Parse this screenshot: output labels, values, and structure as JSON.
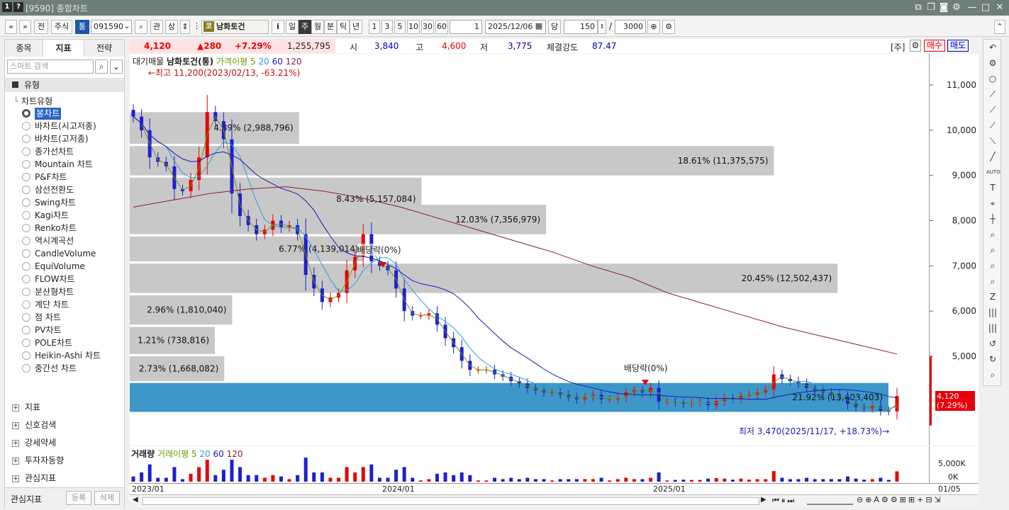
{
  "window": {
    "badge1": "1",
    "badge2": "?",
    "title": "[9590] 종합차트"
  },
  "toolbar": {
    "nav1": "«",
    "nav2": "»",
    "btn_jeon": "전",
    "btn_stock": "주식",
    "btn_tong": "통",
    "code": "091590",
    "search_icon": "⌕",
    "btn_gwan": "관",
    "btn_sang": "상",
    "sector_badge": "코",
    "name": "남화토건",
    "info": "i",
    "periods": [
      "일",
      "주",
      "월",
      "분",
      "틱",
      "년"
    ],
    "selected_period": "주",
    "intervals": [
      "1",
      "3",
      "5",
      "10",
      "30",
      "60"
    ],
    "interval_value": "1",
    "date": "2025/12/06",
    "dang": "당",
    "count": "150",
    "slash": "/",
    "max": "3000"
  },
  "left": {
    "tabs": [
      "종목",
      "지표",
      "전략"
    ],
    "selected_tab": "지표",
    "search_placeholder": "스마트 검색",
    "section": "유형",
    "subsection": "차트유형",
    "items": [
      "봉차트",
      "바차트(시고저종)",
      "바차트(고저종)",
      "종가선차트",
      "Mountain 차트",
      "P&F차트",
      "삼선전환도",
      "Swing차트",
      "Kagi차트",
      "Renko차트",
      "역시계곡선",
      "CandleVolume",
      "EquiVolume",
      "FLOW차트",
      "분산형차트",
      "계단 차트",
      "점 차트",
      "PV차트",
      "POLE차트",
      "Heikin-Ashi 차트",
      "중간선 차트"
    ],
    "groups": [
      "지표",
      "신호검색",
      "강세약세",
      "투자자동향",
      "관심지표"
    ],
    "footer_label": "관심지표",
    "footer_btn1": "등록",
    "footer_btn2": "삭제"
  },
  "quote": {
    "price": "4,120",
    "change": "▲280",
    "pct": "+7.29%",
    "volume": "1,255,795",
    "open_label": "시",
    "open": "3,840",
    "high_label": "고",
    "high": "4,600",
    "low_label": "저",
    "low": "3,775",
    "strength_label": "체결강도",
    "strength": "87.47",
    "unit": "[주]",
    "buy": "매수",
    "sell": "매도"
  },
  "legend": {
    "l1": "대기매물",
    "l2": "남화토건(통)",
    "l3": "가격이평",
    "n5": "5",
    "n20": "20",
    "n60": "60",
    "n120": "120"
  },
  "annotations": {
    "high": "←최고 11,200(2023/02/13, -63.21%)",
    "low": "최저 3,470(2025/11/17, +18.73%)→",
    "div1": "배당락(0%)",
    "div2": "배당락(0%)",
    "last_price": "4,120",
    "last_pct": "(7.29%)"
  },
  "volume_legend": {
    "l1": "거래량",
    "l2": "거래이평",
    "n5": "5",
    "n20": "20",
    "n60": "60",
    "n120": "120"
  },
  "volume_axis": [
    "5,000K",
    "0K"
  ],
  "x_labels": [
    "2023/01",
    "2024/01",
    "2025/01",
    "01/05"
  ],
  "colors": {
    "up": "#e8000b",
    "down": "#1f1fd0",
    "ma5": "#6b9a00",
    "ma20": "#2b9fd8",
    "ma60": "#1a1ab8",
    "ma120": "#8b1a3a",
    "profile": "#c8c8c8",
    "profile_hl": "#3d97c8"
  },
  "chart_data": {
    "type": "candlestick",
    "ylim": [
      3000,
      11900
    ],
    "yticks": [
      5000,
      6000,
      7000,
      8000,
      9000,
      10000,
      11000
    ],
    "volume_profile": [
      {
        "low": 9700,
        "high": 10400,
        "pct": "4.89%",
        "vol": "2,988,796",
        "label": "4.89% (2,988,796)"
      },
      {
        "low": 9000,
        "high": 9650,
        "pct": "18.61%",
        "vol": "11,375,575",
        "label": "18.61% (11,375,575)"
      },
      {
        "low": 8000,
        "high": 8950,
        "pct": "8.43%",
        "vol": "5,157,084",
        "label": "8.43% (5,157,084)"
      },
      {
        "low": 7700,
        "high": 8350,
        "pct": "12.03%",
        "vol": "7,356,979",
        "label": "12.03% (7,356,979)"
      },
      {
        "low": 7100,
        "high": 7650,
        "pct": "6.77%",
        "vol": "4,139,014",
        "label": "6.77% (4,139,014)"
      },
      {
        "low": 6400,
        "high": 7050,
        "pct": "20.45%",
        "vol": "12,502,437",
        "label": "20.45% (12,502,437)"
      },
      {
        "low": 5700,
        "high": 6350,
        "pct": "2.96%",
        "vol": "1,810,040",
        "label": "2.96% (1,810,040)"
      },
      {
        "low": 5050,
        "high": 5650,
        "pct": "1.21%",
        "vol": "738,816",
        "label": "1.21% (738,816)"
      },
      {
        "low": 4450,
        "high": 5000,
        "pct": "2.73%",
        "vol": "1,668,082",
        "label": "2.73% (1,668,082)"
      },
      {
        "low": 3770,
        "high": 4410,
        "pct": "21.92%",
        "vol": "13,403,403",
        "label": "21.92% (13,403,403)",
        "highlight": true
      }
    ],
    "close": [
      10300,
      10000,
      9400,
      9300,
      9200,
      8700,
      8650,
      8900,
      9400,
      10400,
      10200,
      9800,
      8600,
      8100,
      7900,
      7700,
      7800,
      8000,
      7850,
      7900,
      7700,
      6800,
      6500,
      6200,
      6300,
      6400,
      6900,
      7200,
      7700,
      7100,
      7000,
      6900,
      6500,
      6000,
      5900,
      5900,
      5950,
      5700,
      5400,
      5200,
      4900,
      4700,
      4700,
      4700,
      4600,
      4550,
      4450,
      4400,
      4300,
      4250,
      4200,
      4200,
      4150,
      4100,
      4050,
      4100,
      4150,
      4050,
      4050,
      4100,
      4200,
      4250,
      4200,
      4300,
      4000,
      4000,
      3980,
      3950,
      3970,
      3990,
      3920,
      4010,
      4080,
      4050,
      4120,
      4150,
      4200,
      4250,
      4600,
      4500,
      4450,
      4400,
      4300,
      4250,
      4200,
      4150,
      4100,
      3950,
      3880,
      3850,
      3900,
      3800,
      3780,
      4120
    ],
    "ma120_pts": [
      8300,
      8450,
      8600,
      8700,
      8750,
      8650,
      8500,
      8300,
      8050,
      7800,
      7550,
      7300,
      7000,
      6750,
      6400,
      6150,
      5900,
      5650,
      5450,
      5250,
      5050
    ]
  },
  "axis_ticks": [
    "11,000",
    "10,000",
    "9,000",
    "8,000",
    "7,000",
    "6,000",
    "5,000"
  ],
  "right_tools": [
    "↶",
    "⚙",
    "○",
    "⟋",
    "⟋",
    "⟋",
    "⟍",
    "╱",
    "AUTO",
    "T",
    "⌖",
    "┼",
    "⌕",
    "⌕",
    "⌕",
    "⌕",
    "Z",
    "|||",
    "|||",
    "↺",
    "↻",
    "⌕"
  ]
}
